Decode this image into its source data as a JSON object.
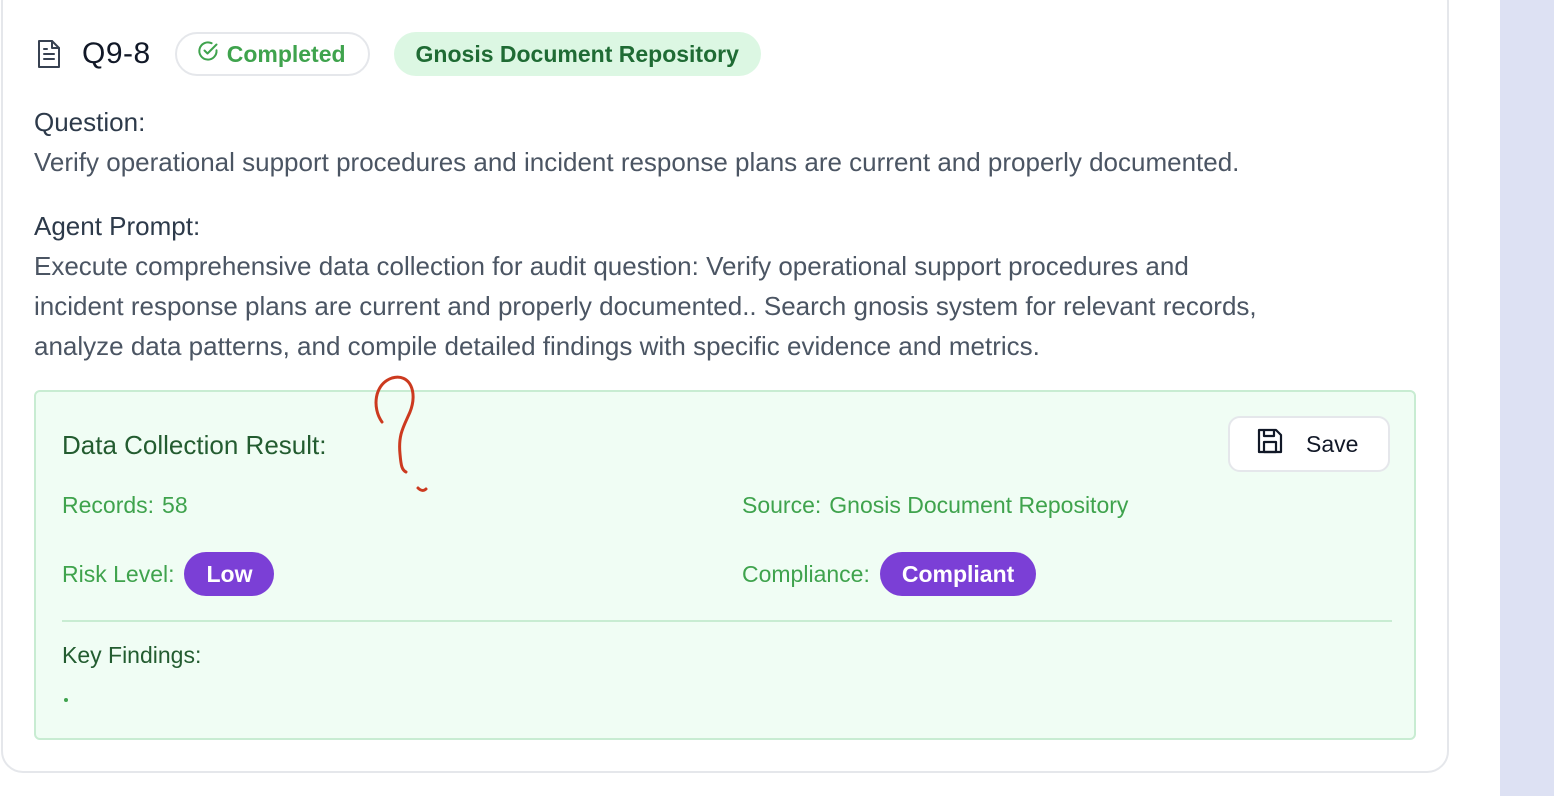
{
  "header": {
    "id": "Q9-8",
    "status": "Completed",
    "source_tag": "Gnosis Document Repository",
    "icons": {
      "document": "document-icon",
      "status": "check-circle-icon"
    }
  },
  "question": {
    "label": "Question:",
    "text": "Verify operational support procedures and incident response plans are current and properly documented."
  },
  "agent_prompt": {
    "label": "Agent Prompt:",
    "lines": [
      "Execute comprehensive data collection for audit question: Verify operational support procedures and",
      "incident response plans are current and properly documented.. Search gnosis system for relevant records,",
      "analyze data patterns, and compile detailed findings with specific evidence and metrics."
    ]
  },
  "result": {
    "title": "Data Collection Result:",
    "save_label": "Save",
    "save_icon": "floppy-disk-icon",
    "records_label": "Records:",
    "records_value": "58",
    "source_label": "Source:",
    "source_value": "Gnosis Document Repository",
    "risk_label": "Risk Level:",
    "risk_value": "Low",
    "compliance_label": "Compliance:",
    "compliance_value": "Compliant",
    "key_findings_label": "Key Findings:"
  },
  "colors": {
    "accent_green": "#3fa34d",
    "dark_green": "#235c30",
    "badge_purple": "#7b3fd6",
    "result_bg": "#f0fdf4",
    "annotation_red": "#cc3a1f"
  }
}
